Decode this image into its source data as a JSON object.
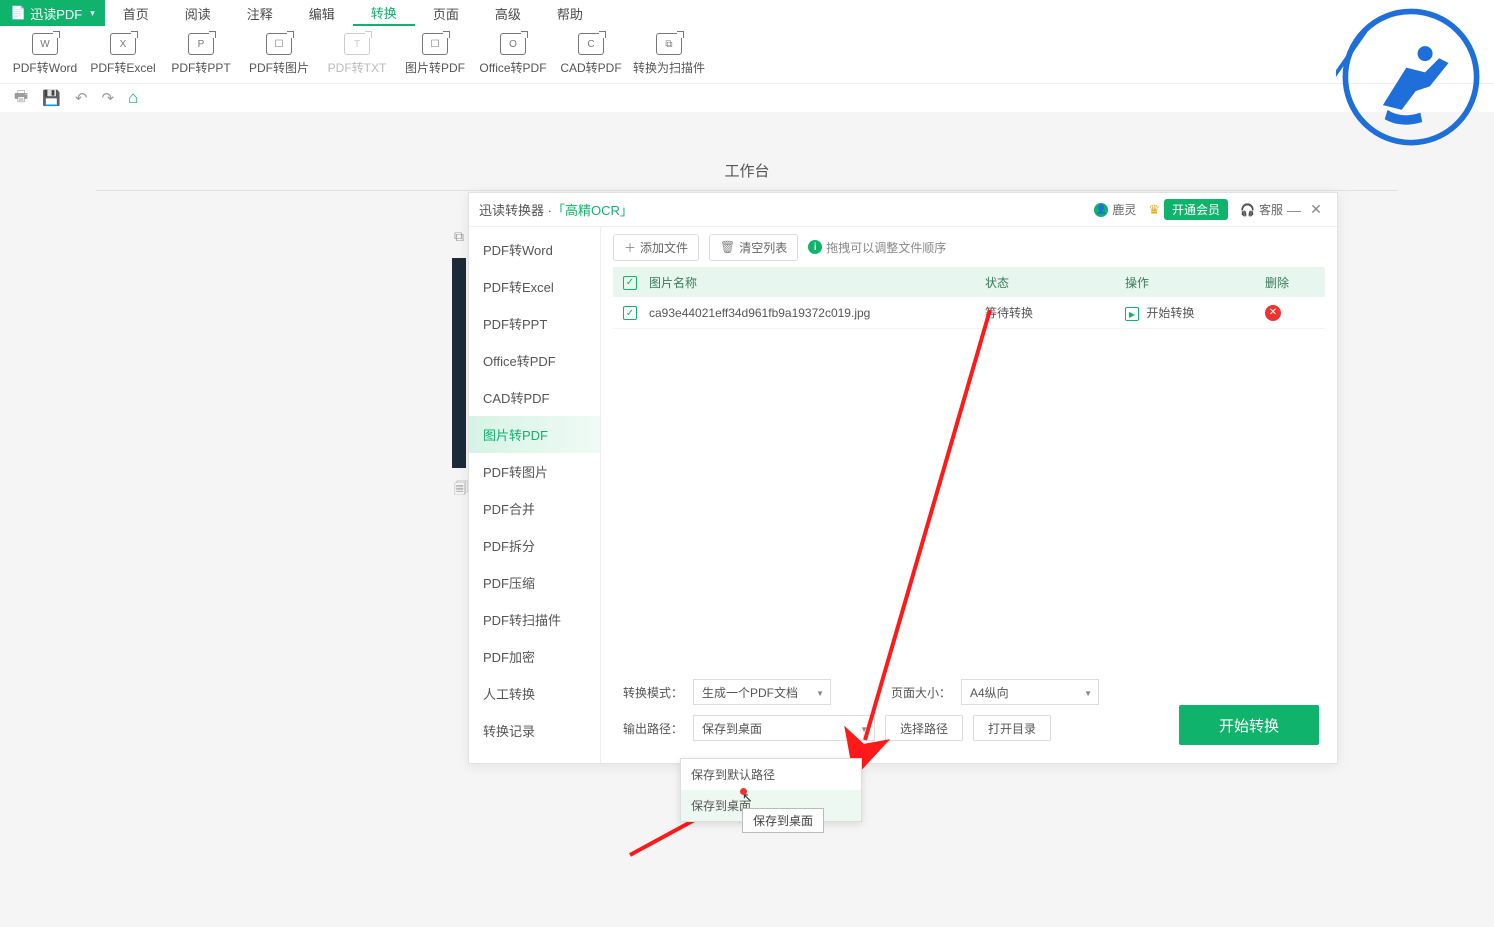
{
  "app": {
    "name": "迅读PDF",
    "workbench": "工作台"
  },
  "menu": {
    "items": [
      "首页",
      "阅读",
      "注释",
      "编辑",
      "转换",
      "页面",
      "高级",
      "帮助"
    ],
    "active_index": 4
  },
  "ribbon": [
    {
      "label": "PDF转Word",
      "sub": "W"
    },
    {
      "label": "PDF转Excel",
      "sub": "X"
    },
    {
      "label": "PDF转PPT",
      "sub": "P"
    },
    {
      "label": "PDF转图片",
      "sub": "☐"
    },
    {
      "label": "PDF转TXT",
      "sub": "T",
      "disabled": true
    },
    {
      "label": "图片转PDF",
      "sub": "☐"
    },
    {
      "label": "Office转PDF",
      "sub": "O"
    },
    {
      "label": "CAD转PDF",
      "sub": "C"
    },
    {
      "label": "转换为扫描件",
      "sub": "⧉"
    }
  ],
  "modal": {
    "title_prefix": "迅读转换器 · ",
    "title_ocr": "「高精OCR」",
    "user": "鹿灵",
    "vip_btn": "开通会员",
    "support": "客服",
    "sidebar": [
      "PDF转Word",
      "PDF转Excel",
      "PDF转PPT",
      "Office转PDF",
      "CAD转PDF",
      "图片转PDF",
      "PDF转图片",
      "PDF合并",
      "PDF拆分",
      "PDF压缩",
      "PDF转扫描件",
      "PDF加密",
      "人工转换",
      "转换记录"
    ],
    "sidebar_active": 5,
    "toolbar": {
      "add": "添加文件",
      "clear": "清空列表",
      "hint": "拖拽可以调整文件顺序"
    },
    "table": {
      "headers": {
        "name": "图片名称",
        "state": "状态",
        "op": "操作",
        "del": "删除"
      },
      "rows": [
        {
          "name": "ca93e44021eff34d961fb9a19372c019.jpg",
          "state": "等待转换",
          "op": "开始转换"
        }
      ]
    },
    "controls": {
      "mode_label": "转换模式：",
      "mode_value": "生成一个PDF文档",
      "size_label": "页面大小：",
      "size_value": "A4纵向",
      "out_label": "输出路径：",
      "out_value": "保存到桌面",
      "choose": "选择路径",
      "open": "打开目录",
      "start": "开始转换",
      "dropdown": {
        "opt1": "保存到默认路径",
        "opt2": "保存到桌面"
      },
      "tooltip": "保存到桌面"
    }
  }
}
